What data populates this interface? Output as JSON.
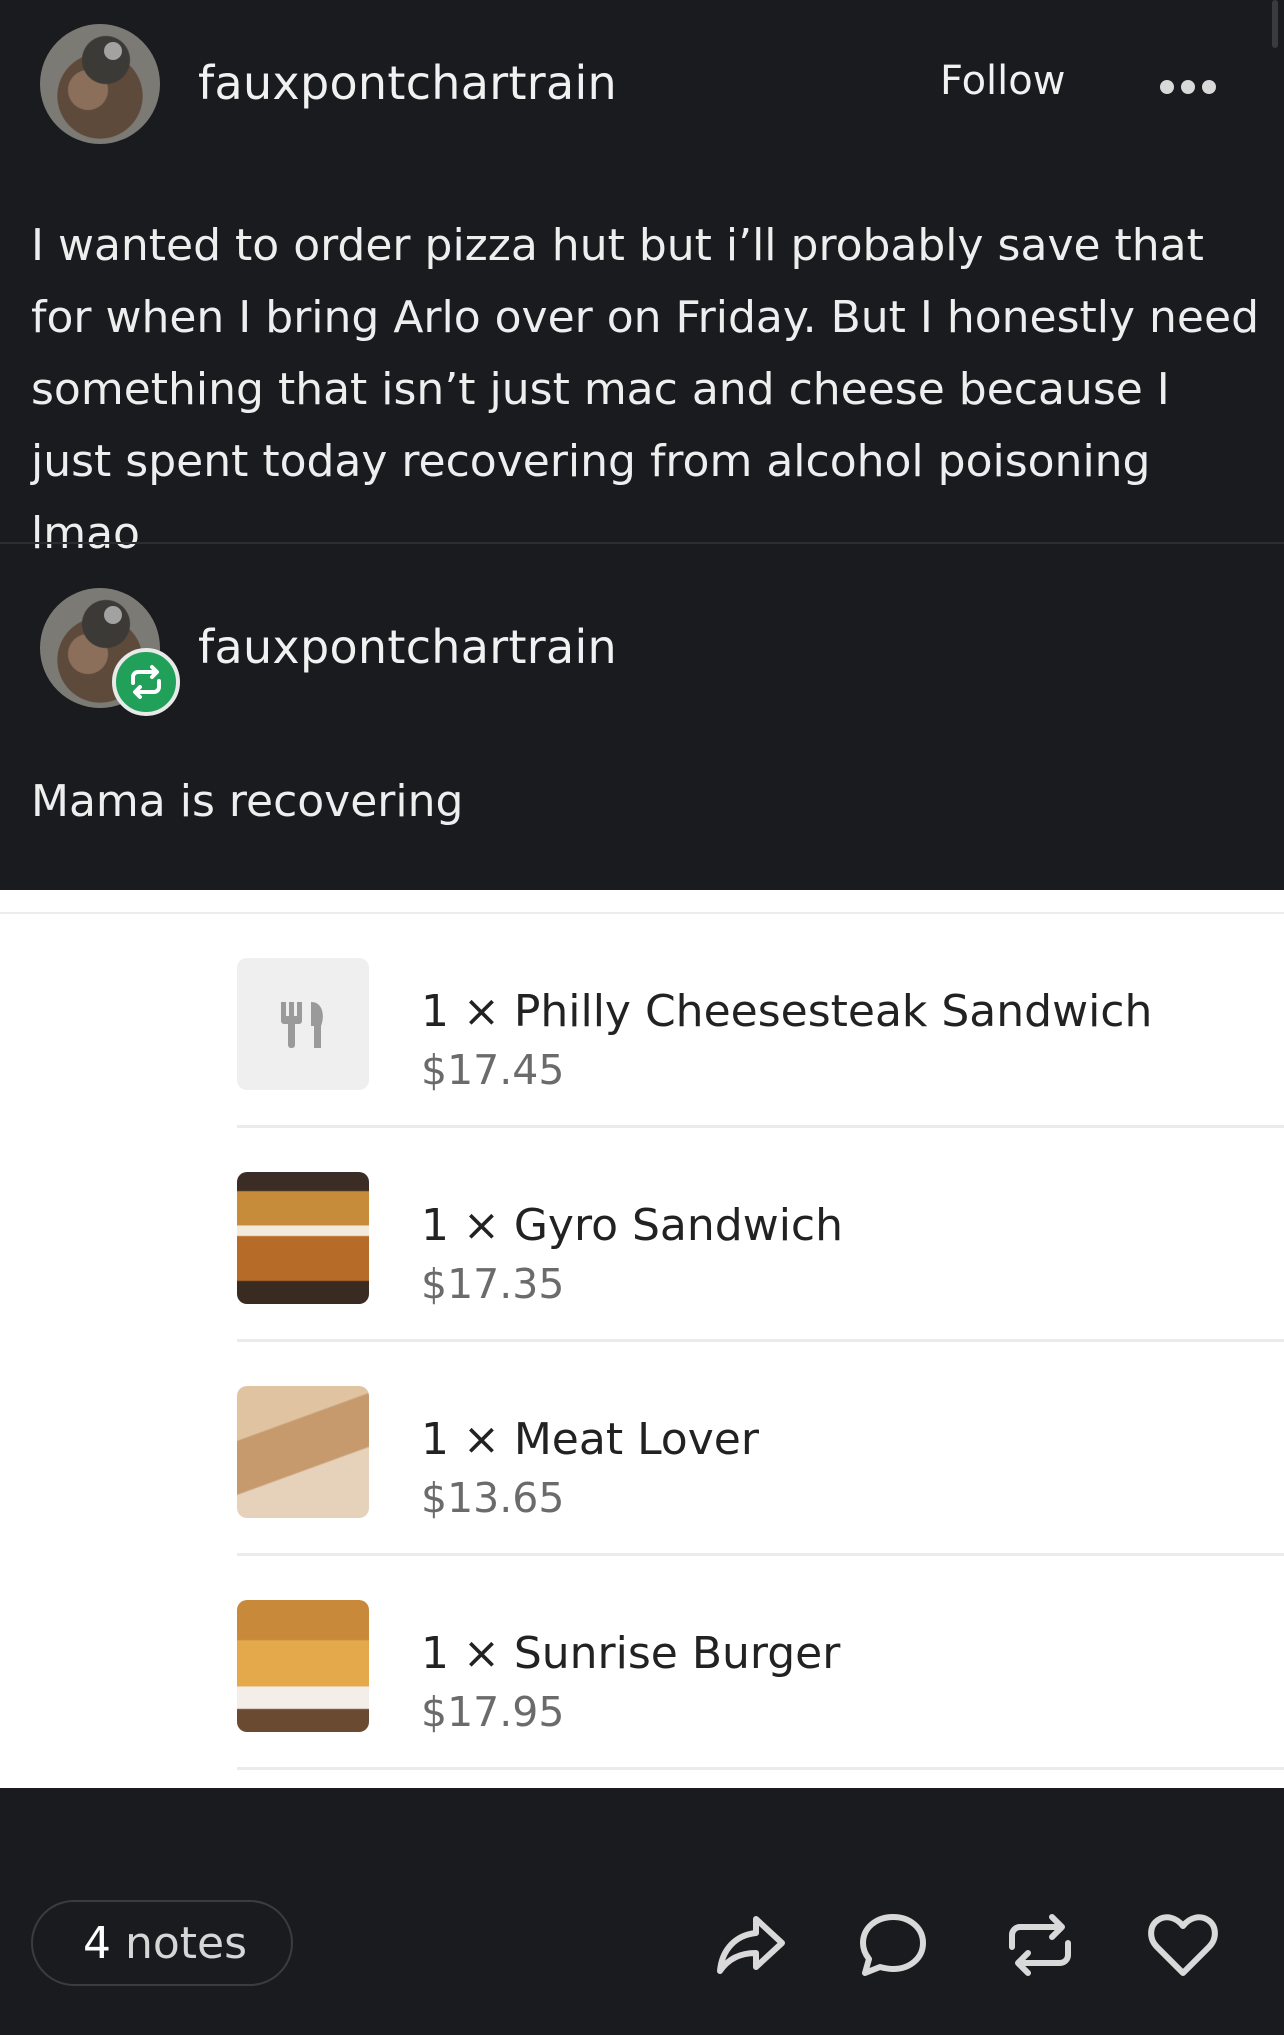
{
  "post": {
    "author": "fauxpontchartrain",
    "follow_label": "Follow",
    "text": "I wanted to order pizza hut but i’ll probably save that for when I bring Arlo over on Friday. But I honestly need something that isn’t just mac and cheese because I just spent today recovering from alcohol poisoning lmao"
  },
  "reblog": {
    "author": "fauxpontchartrain",
    "text": "Mama is recovering"
  },
  "order_items": [
    {
      "name": "1 × Philly Cheesesteak Sandwich",
      "price": "$17.45",
      "image": "utensils-placeholder"
    },
    {
      "name": "1 ×  Gyro Sandwich",
      "price": "$17.35",
      "image": "food-photo"
    },
    {
      "name": "1 × Meat Lover",
      "price": "$13.65",
      "image": "food-photo"
    },
    {
      "name": "1 × Sunrise Burger",
      "price": "$17.95",
      "image": "food-photo"
    }
  ],
  "footer": {
    "notes_count": "4",
    "notes_label": "notes",
    "actions": [
      "share-icon",
      "comment-icon",
      "reblog-icon",
      "heart-icon"
    ]
  },
  "colors": {
    "background": "#1a1b1e",
    "reblog_badge": "#21a05a",
    "panel": "#ffffff"
  }
}
